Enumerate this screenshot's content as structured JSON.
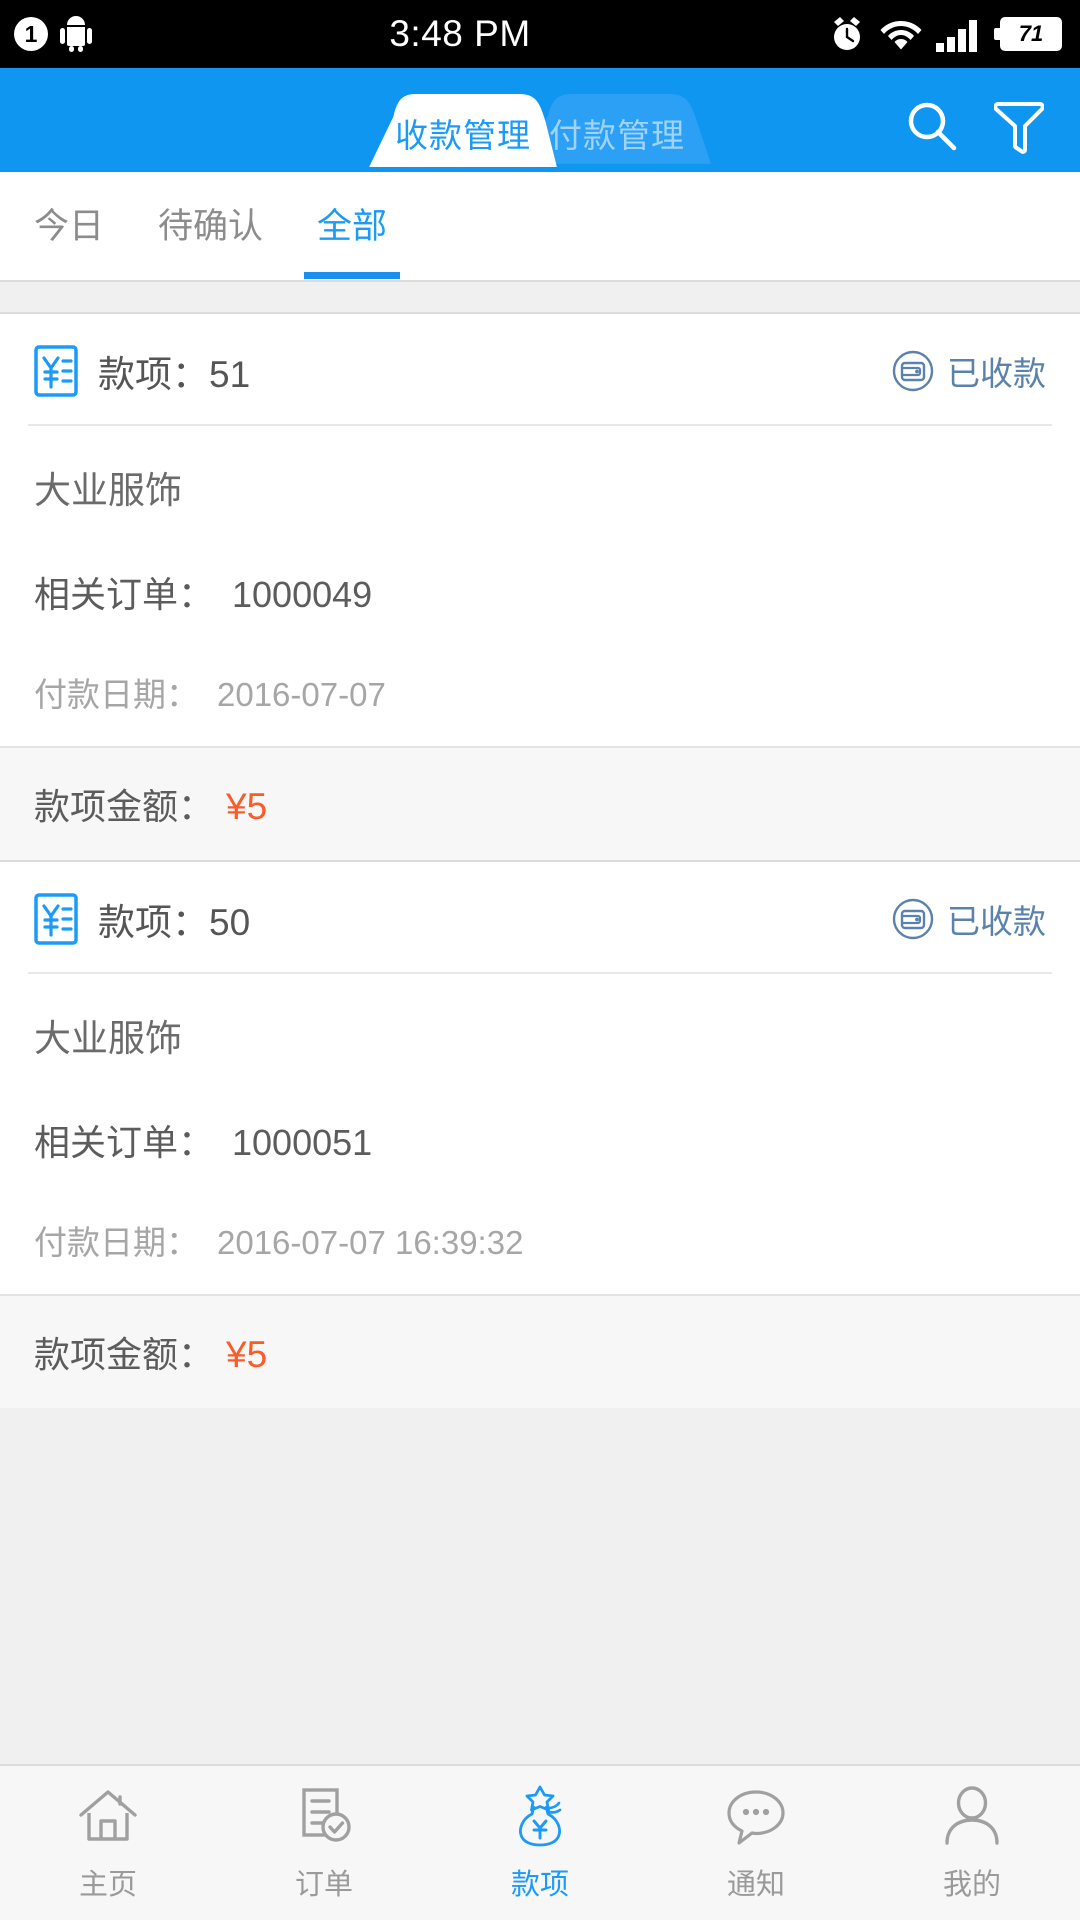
{
  "statusbar": {
    "notification_count": "1",
    "time": "3:48 PM",
    "battery_level": "71",
    "icons": [
      "android-robot-icon",
      "alarm-clock-icon",
      "wifi-icon",
      "cellular-signal-icon",
      "battery-icon"
    ]
  },
  "header": {
    "segments": [
      {
        "label": "收款管理",
        "active": true
      },
      {
        "label": "付款管理",
        "active": false
      }
    ],
    "actions": [
      {
        "name": "search-icon",
        "label": "搜索"
      },
      {
        "name": "filter-icon",
        "label": "筛选"
      }
    ],
    "accent_color": "#0e96f0"
  },
  "subtabs": [
    {
      "label": "今日",
      "active": false
    },
    {
      "label": "待确认",
      "active": false
    },
    {
      "label": "全部",
      "active": true
    }
  ],
  "labels": {
    "item_prefix": "款项：",
    "company_label": "",
    "order_label": "相关订单：",
    "date_label": "付款日期：",
    "amount_label": "款项金额："
  },
  "cards": [
    {
      "title": "款项：51",
      "status": "已收款",
      "company": "大业服饰",
      "order_label": "相关订单：",
      "order_value": "1000049",
      "date_label": "付款日期：",
      "date_value": "2016-07-07",
      "amount_label": "款项金额：",
      "amount_value": "¥5"
    },
    {
      "title": "款项：50",
      "status": "已收款",
      "company": "大业服饰",
      "order_label": "相关订单：",
      "order_value": "1000051",
      "date_label": "付款日期：",
      "date_value": "2016-07-07 16:39:32",
      "amount_label": "款项金额：",
      "amount_value": "¥5"
    }
  ],
  "bottomnav": [
    {
      "label": "主页",
      "icon": "home-icon",
      "active": false
    },
    {
      "label": "订单",
      "icon": "order-document-check-icon",
      "active": false
    },
    {
      "label": "款项",
      "icon": "money-bag-icon",
      "active": true
    },
    {
      "label": "通知",
      "icon": "chat-bubble-icon",
      "active": false
    },
    {
      "label": "我的",
      "icon": "person-icon",
      "active": false
    }
  ],
  "colors": {
    "accent": "#1b9af7",
    "header_blue": "#0e96f0",
    "amount_orange": "#fa5c28",
    "status_blue_gray": "#5b82ad"
  }
}
